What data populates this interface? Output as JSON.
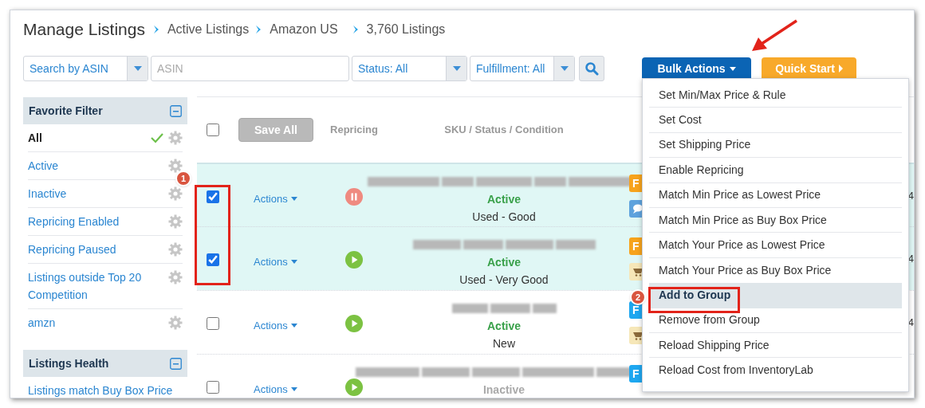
{
  "page": {
    "title": "Manage Listings",
    "breadcrumbs": [
      "Active Listings",
      "Amazon US",
      "3,760 Listings"
    ]
  },
  "filters": {
    "search_by": "Search by ASIN",
    "search": {
      "placeholder": "ASIN"
    },
    "status": "Status: All",
    "fulfillment": "Fulfillment: All"
  },
  "bulk_actions": {
    "label": "Bulk Actions",
    "expanded": true,
    "menu": [
      {
        "label": "Set Min/Max Price & Rule",
        "selected": false
      },
      {
        "label": "Set Cost",
        "selected": false
      },
      {
        "label": "Set Shipping Price",
        "selected": false
      },
      {
        "label": "Enable Repricing",
        "selected": false
      },
      {
        "label": "Match Min Price as Lowest Price",
        "selected": false
      },
      {
        "label": "Match Min Price as Buy Box Price",
        "selected": false
      },
      {
        "label": "Match Your Price as Lowest Price",
        "selected": false
      },
      {
        "label": "Match Your Price as Buy Box Price",
        "selected": false
      },
      {
        "label": "Add to Group",
        "selected": true
      },
      {
        "label": "Remove from Group",
        "selected": false
      },
      {
        "label": "Reload Shipping Price",
        "selected": false
      },
      {
        "label": "Reload Cost from InventoryLab",
        "selected": false
      }
    ]
  },
  "quick_start": "Quick Start",
  "sidebar": {
    "sections": [
      {
        "title": "Favorite Filter",
        "expanded": true,
        "items": [
          {
            "label": "All",
            "selected": true
          },
          {
            "label": "Active",
            "selected": false
          },
          {
            "label": "Inactive",
            "selected": false
          },
          {
            "label": "Repricing Enabled",
            "selected": false
          },
          {
            "label": "Repricing Paused",
            "selected": false
          },
          {
            "label": "Listings outside Top 20 Competition",
            "selected": false
          },
          {
            "label": "amzn",
            "selected": false
          }
        ]
      },
      {
        "title": "Listings Health",
        "expanded": true,
        "items": [
          {
            "label": "Listings match Buy Box Price",
            "selected": false
          }
        ]
      }
    ]
  },
  "table": {
    "header": {
      "checked": false,
      "save": "Save All",
      "columns": [
        "Repricing",
        "SKU / Status / Condition"
      ]
    },
    "rows": [
      {
        "kind": "chat",
        "checked": true,
        "actions": "Actions",
        "paused": true,
        "status": "Active",
        "active": true,
        "condition": "Used - Good",
        "badge": "F",
        "color": "#f7a31c",
        "date": "4"
      },
      {
        "kind": "cart",
        "checked": true,
        "actions": "Actions",
        "paused": false,
        "status": "Active",
        "active": true,
        "condition": "Used - Very Good",
        "badge": "F",
        "color": "#f7a31c",
        "date": "4"
      },
      {
        "kind": "cart",
        "checked": false,
        "actions": "Actions",
        "paused": false,
        "status": "Active",
        "active": true,
        "condition": "New",
        "badge": "F",
        "color": "#1ea7f0",
        "date": "4"
      },
      {
        "kind": "plain",
        "checked": false,
        "actions": "Actions",
        "paused": false,
        "status": "Inactive",
        "active": false,
        "badge": "F",
        "color": "#1ea7f0"
      }
    ]
  },
  "annotations": {
    "markers": [
      "1",
      "2"
    ]
  }
}
